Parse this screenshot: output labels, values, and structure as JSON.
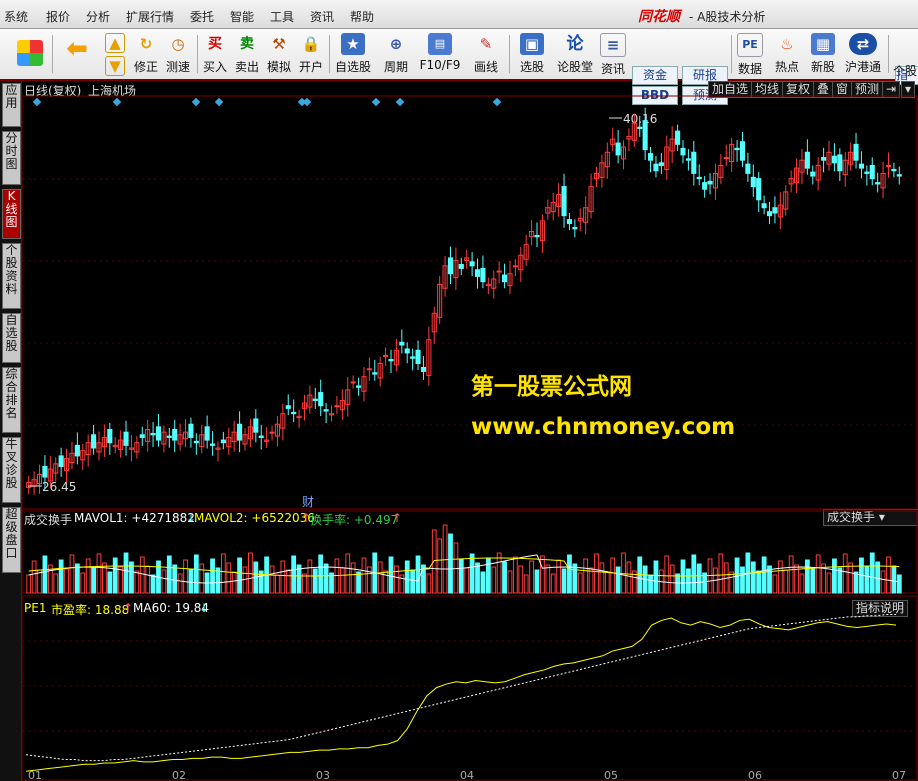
{
  "menu": {
    "items": [
      "系统",
      "报价",
      "分析",
      "扩展行情",
      "委托",
      "智能",
      "工具",
      "资讯",
      "帮助"
    ],
    "brand": "同花顺",
    "title": "- A股技术分析"
  },
  "toolbar": {
    "buttons": [
      "修正",
      "测速",
      "买入",
      "卖出",
      "模拟",
      "开户",
      "自选股",
      "周期",
      "F10/F9",
      "画线",
      "选股",
      "论股堂",
      "资讯",
      "数据",
      "热点",
      "新股",
      "沪港通",
      "个股"
    ],
    "buy_icon": "买",
    "sell_icon": "卖",
    "lun_icon": "论",
    "pe_icon": "PE",
    "box": [
      "资金",
      "研报",
      "BBD",
      "预测"
    ],
    "cut": "指数"
  },
  "left_tabs": [
    "应用",
    "分时图",
    "K线图",
    "个股资料",
    "自选股",
    "综合排名",
    "牛叉诊股",
    "超级盘口"
  ],
  "chart": {
    "header_mode": "日线(复权)",
    "stock": "上海机场",
    "right_buttons": [
      "加自选",
      "均线",
      "复权",
      "叠",
      "窗",
      "预测"
    ],
    "high_label": "40.16",
    "low_label": "26.45",
    "cai": "财",
    "vol_title": "成交换手",
    "mavol1": "MAVOL1: +4271882",
    "mavol2": "MAVOL2: +6522036",
    "turnover": "换手率: +0.497",
    "vol_dropdown": "成交换手",
    "pe_title": "PE1",
    "pe_val": "市盈率: 18.88",
    "ma60": "MA60: 19.84",
    "pe_btn": "指标说明",
    "x_ticks": [
      "01",
      "02",
      "03",
      "04",
      "05",
      "06",
      "07"
    ],
    "colors": {
      "up": "#ff3c3c",
      "down": "#54ffff",
      "bg": "#000000",
      "ma1": "#ffffff",
      "ma2": "#ffff00"
    }
  },
  "watermark": {
    "line1": "第一股票公式网",
    "line2": "www.chnmoney.com"
  },
  "chart_data": {
    "type": "candlestick",
    "price_range": [
      26.45,
      40.16
    ],
    "closes": [
      26.4,
      26.5,
      26.7,
      26.6,
      26.9,
      27.1,
      27.0,
      27.3,
      27.5,
      27.4,
      27.6,
      27.9,
      27.7,
      27.9,
      28.1,
      27.9,
      27.8,
      28.0,
      27.8,
      27.7,
      27.9,
      28.1,
      28.4,
      28.2,
      28.0,
      28.3,
      28.1,
      28.0,
      28.2,
      28.3,
      28.1,
      27.9,
      28.2,
      28.0,
      27.8,
      27.7,
      27.9,
      28.1,
      28.3,
      28.0,
      28.2,
      28.5,
      28.3,
      28.1,
      28.0,
      28.3,
      28.6,
      29.0,
      29.2,
      29.0,
      28.9,
      29.4,
      29.7,
      29.5,
      29.3,
      29.1,
      29.0,
      29.3,
      29.5,
      29.9,
      30.2,
      30.0,
      30.4,
      30.7,
      30.5,
      30.9,
      31.2,
      31.0,
      31.4,
      31.6,
      31.3,
      31.1,
      30.9,
      30.6,
      31.8,
      32.8,
      33.9,
      34.6,
      34.3,
      34.8,
      34.5,
      34.9,
      34.6,
      34.2,
      34.0,
      33.9,
      34.1,
      34.4,
      34.0,
      34.3,
      34.6,
      35.0,
      35.4,
      35.9,
      35.7,
      36.3,
      36.8,
      37.0,
      37.3,
      36.5,
      36.2,
      36.0,
      36.4,
      36.8,
      37.6,
      38.1,
      38.5,
      38.9,
      39.4,
      38.8,
      39.1,
      39.5,
      40.0,
      39.8,
      39.0,
      38.6,
      38.2,
      38.4,
      39.1,
      39.4,
      39.2,
      38.8,
      38.6,
      38.1,
      37.9,
      37.5,
      37.7,
      38.1,
      38.4,
      38.7,
      39.2,
      39.0,
      38.6,
      38.1,
      37.6,
      37.1,
      36.8,
      36.5,
      36.6,
      36.9,
      37.4,
      37.9,
      38.3,
      38.6,
      38.3,
      38.0,
      38.4,
      38.6,
      38.9,
      38.5,
      38.2,
      38.6,
      38.9,
      38.6,
      38.3,
      38.1,
      37.9,
      37.7,
      38.1,
      38.4,
      38.2,
      38.0
    ],
    "vol_series": [
      {
        "name": "MAVOL1"
      },
      {
        "name": "MAVOL2"
      }
    ],
    "pe_values": [
      4,
      5,
      6,
      7,
      8,
      9,
      10,
      10,
      11,
      11,
      12,
      13,
      12,
      12,
      13,
      14,
      14,
      15,
      15,
      16,
      16,
      15,
      15,
      16,
      17,
      18,
      19,
      20,
      20,
      21,
      22,
      22,
      23,
      23,
      24,
      24,
      26,
      27,
      30,
      40,
      55,
      68,
      75,
      78,
      80,
      79,
      81,
      80,
      79,
      80,
      83,
      86,
      88,
      90,
      93,
      95,
      96,
      98,
      100,
      102,
      106,
      108,
      110,
      116,
      128,
      132,
      134,
      130,
      128,
      131,
      129,
      126,
      128,
      132,
      133,
      129,
      126,
      125,
      124,
      126,
      128,
      130,
      131,
      129,
      127,
      126,
      127,
      128,
      129,
      128
    ],
    "ma60_values": [
      18,
      17,
      16,
      15,
      14,
      14,
      13,
      13,
      13,
      14,
      14,
      15,
      16,
      17,
      18,
      19,
      20,
      21,
      22,
      23,
      24,
      25,
      26,
      27,
      28,
      29,
      30,
      31,
      33,
      35,
      37,
      39,
      41,
      43,
      45,
      47,
      49,
      51,
      53,
      55,
      57,
      59,
      61,
      63,
      65,
      67,
      69,
      71,
      73,
      75,
      77,
      79,
      81,
      83,
      85,
      87,
      89,
      91,
      93,
      95,
      97,
      99,
      101,
      103,
      105,
      107,
      109,
      111,
      113,
      115,
      117,
      119,
      121,
      123,
      125,
      126,
      127,
      128,
      129,
      130,
      131,
      132,
      133,
      134,
      135,
      135,
      136,
      136,
      137,
      137
    ]
  }
}
